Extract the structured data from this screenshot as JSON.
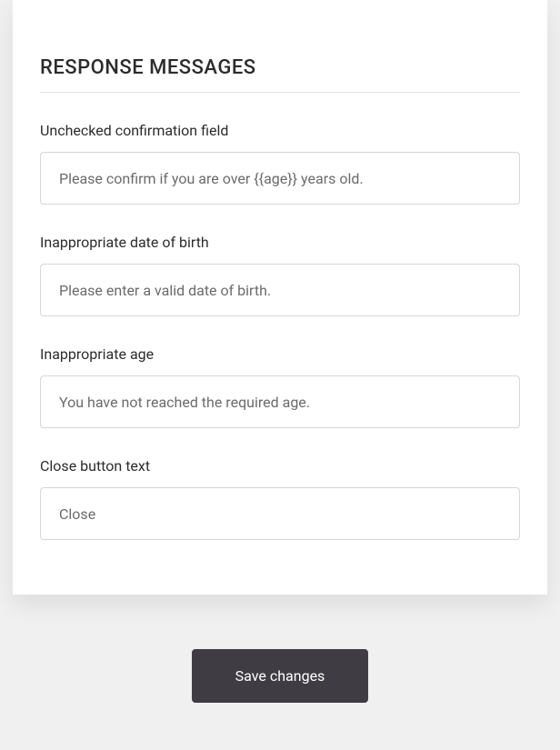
{
  "section": {
    "title": "RESPONSE MESSAGES"
  },
  "fields": {
    "unchecked_confirmation": {
      "label": "Unchecked confirmation field",
      "value": "Please confirm if you are over {{age}} years old."
    },
    "inappropriate_dob": {
      "label": "Inappropriate date of birth",
      "value": "Please enter a valid date of birth."
    },
    "inappropriate_age": {
      "label": "Inappropriate age",
      "value": "You have not reached the required age."
    },
    "close_button_text": {
      "label": "Close button text",
      "value": "Close"
    }
  },
  "actions": {
    "save_label": "Save changes"
  }
}
